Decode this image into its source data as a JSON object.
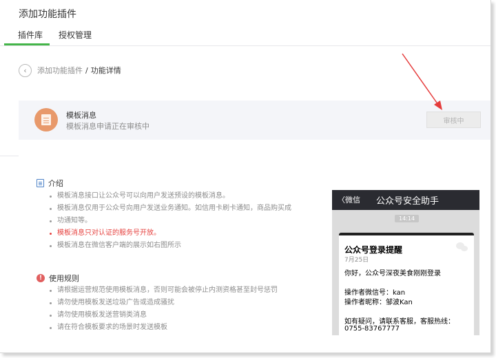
{
  "header": {
    "title": "添加功能插件"
  },
  "tabs": [
    {
      "label": "插件库",
      "active": true
    },
    {
      "label": "授权管理",
      "active": false
    }
  ],
  "breadcrumb": {
    "back_icon": "chevron-left-icon",
    "parent": "添加功能插件",
    "separator": "/",
    "current": "功能详情"
  },
  "plugin": {
    "icon": "document-icon",
    "name": "模板消息",
    "status_text": "模板消息申请正在审核中",
    "review_button": "审核中"
  },
  "intro": {
    "title": "介绍",
    "items": [
      {
        "text": "模板消息接口让公众号可以向用户发送预设的模板消息。",
        "highlight": false
      },
      {
        "text": "模板消息仅用于公众号向用户发送业务通知。如信用卡刷卡通知，商品购买成",
        "cont": "功通知等。",
        "highlight": false
      },
      {
        "text": "模板消息只对认证的服务号开放。",
        "highlight": true
      },
      {
        "text": "模板消息在微信客户端的展示如右图所示",
        "highlight": false
      }
    ]
  },
  "rules": {
    "title": "使用规则",
    "items": [
      "请根据运营规范使用模板消息，否则可能会被停止内测资格甚至封号惩罚",
      "请勿使用模板发送垃圾广告或造成骚扰",
      "请勿使用模板发送营销类消息",
      "请在符合模板要求的场景时发送模板"
    ]
  },
  "phone": {
    "back_label": "〈微信",
    "title": "公众号安全助手",
    "time": "14:14",
    "card": {
      "title": "公众号登录提醒",
      "date": "7月25日",
      "line1": "你好，公众号深夜美食刚刚登录",
      "line2": "操作者微信号：kan",
      "line3": "操作者昵称：邹波Kan",
      "line4": "如有疑问，请联系客服，客服热线：",
      "line5": "0755-83767777"
    }
  },
  "colors": {
    "accent": "#44b549",
    "warning": "#e64340",
    "annotation_arrow": "#e53b3b"
  }
}
